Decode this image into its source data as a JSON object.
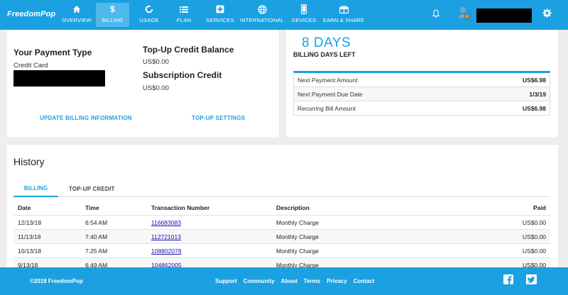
{
  "brand": {
    "logo_text": "FreedomPop"
  },
  "nav": {
    "items": [
      {
        "label": "OVERVIEW",
        "icon": "home-icon"
      },
      {
        "label": "BILLING",
        "icon": "dollar-icon"
      },
      {
        "label": "USAGE",
        "icon": "usage-ring-icon"
      },
      {
        "label": "PLAN",
        "icon": "list-icon"
      },
      {
        "label": "SERVICES",
        "icon": "add-box-icon"
      },
      {
        "label": "INTERNATIONAL",
        "icon": "globe-icon"
      },
      {
        "label": "DEVICES",
        "icon": "phone-icon"
      },
      {
        "label": "EARN & SHARE",
        "icon": "gift-icon"
      }
    ],
    "active": "BILLING"
  },
  "payment": {
    "type_heading": "Your Payment Type",
    "type_value": "Credit Card",
    "topup_heading": "Top-Up Credit Balance",
    "topup_value": "US$0.00",
    "sub_heading": "Subscription Credit",
    "sub_value": "US$0.00",
    "update_link": "UPDATE BILLING INFORMATION",
    "topup_settings_link": "TOP-UP SETTINGS"
  },
  "billing_days": {
    "count": "8 DAYS",
    "label": "BILLING DAYS LEFT",
    "rows": [
      {
        "key": "Next Payment Amount",
        "value": "US$6.98"
      },
      {
        "key": "Next Payment Due Date",
        "value": "1/3/19"
      },
      {
        "key": "Recurring Bill Amount",
        "value": "US$6.98"
      }
    ]
  },
  "history": {
    "title": "History",
    "tabs": [
      "BILLING",
      "TOP-UP CREDIT"
    ],
    "columns": [
      "Date",
      "Time",
      "Transaction Number",
      "Description",
      "Paid"
    ],
    "rows": [
      [
        "12/13/18",
        "6:54 AM",
        "116683083",
        "Monthly Charge",
        "US$0.00"
      ],
      [
        "11/13/18",
        "7:40 AM",
        "112721013",
        "Monthly Charge",
        "US$0.00"
      ],
      [
        "10/13/18",
        "7:25 AM",
        "108802078",
        "Monthly Charge",
        "US$0.00"
      ],
      [
        "9/13/18",
        "6:49 AM",
        "104862005",
        "Monthly Charge",
        "US$0.00"
      ]
    ]
  },
  "footer": {
    "copyright": "©2018 FreedomPop",
    "links": [
      "Support",
      "Community",
      "About",
      "Terms",
      "Privacy",
      "Contact"
    ]
  },
  "colors": {
    "brand_blue": "#1ba0e2",
    "link_blue": "#1a0dab"
  }
}
